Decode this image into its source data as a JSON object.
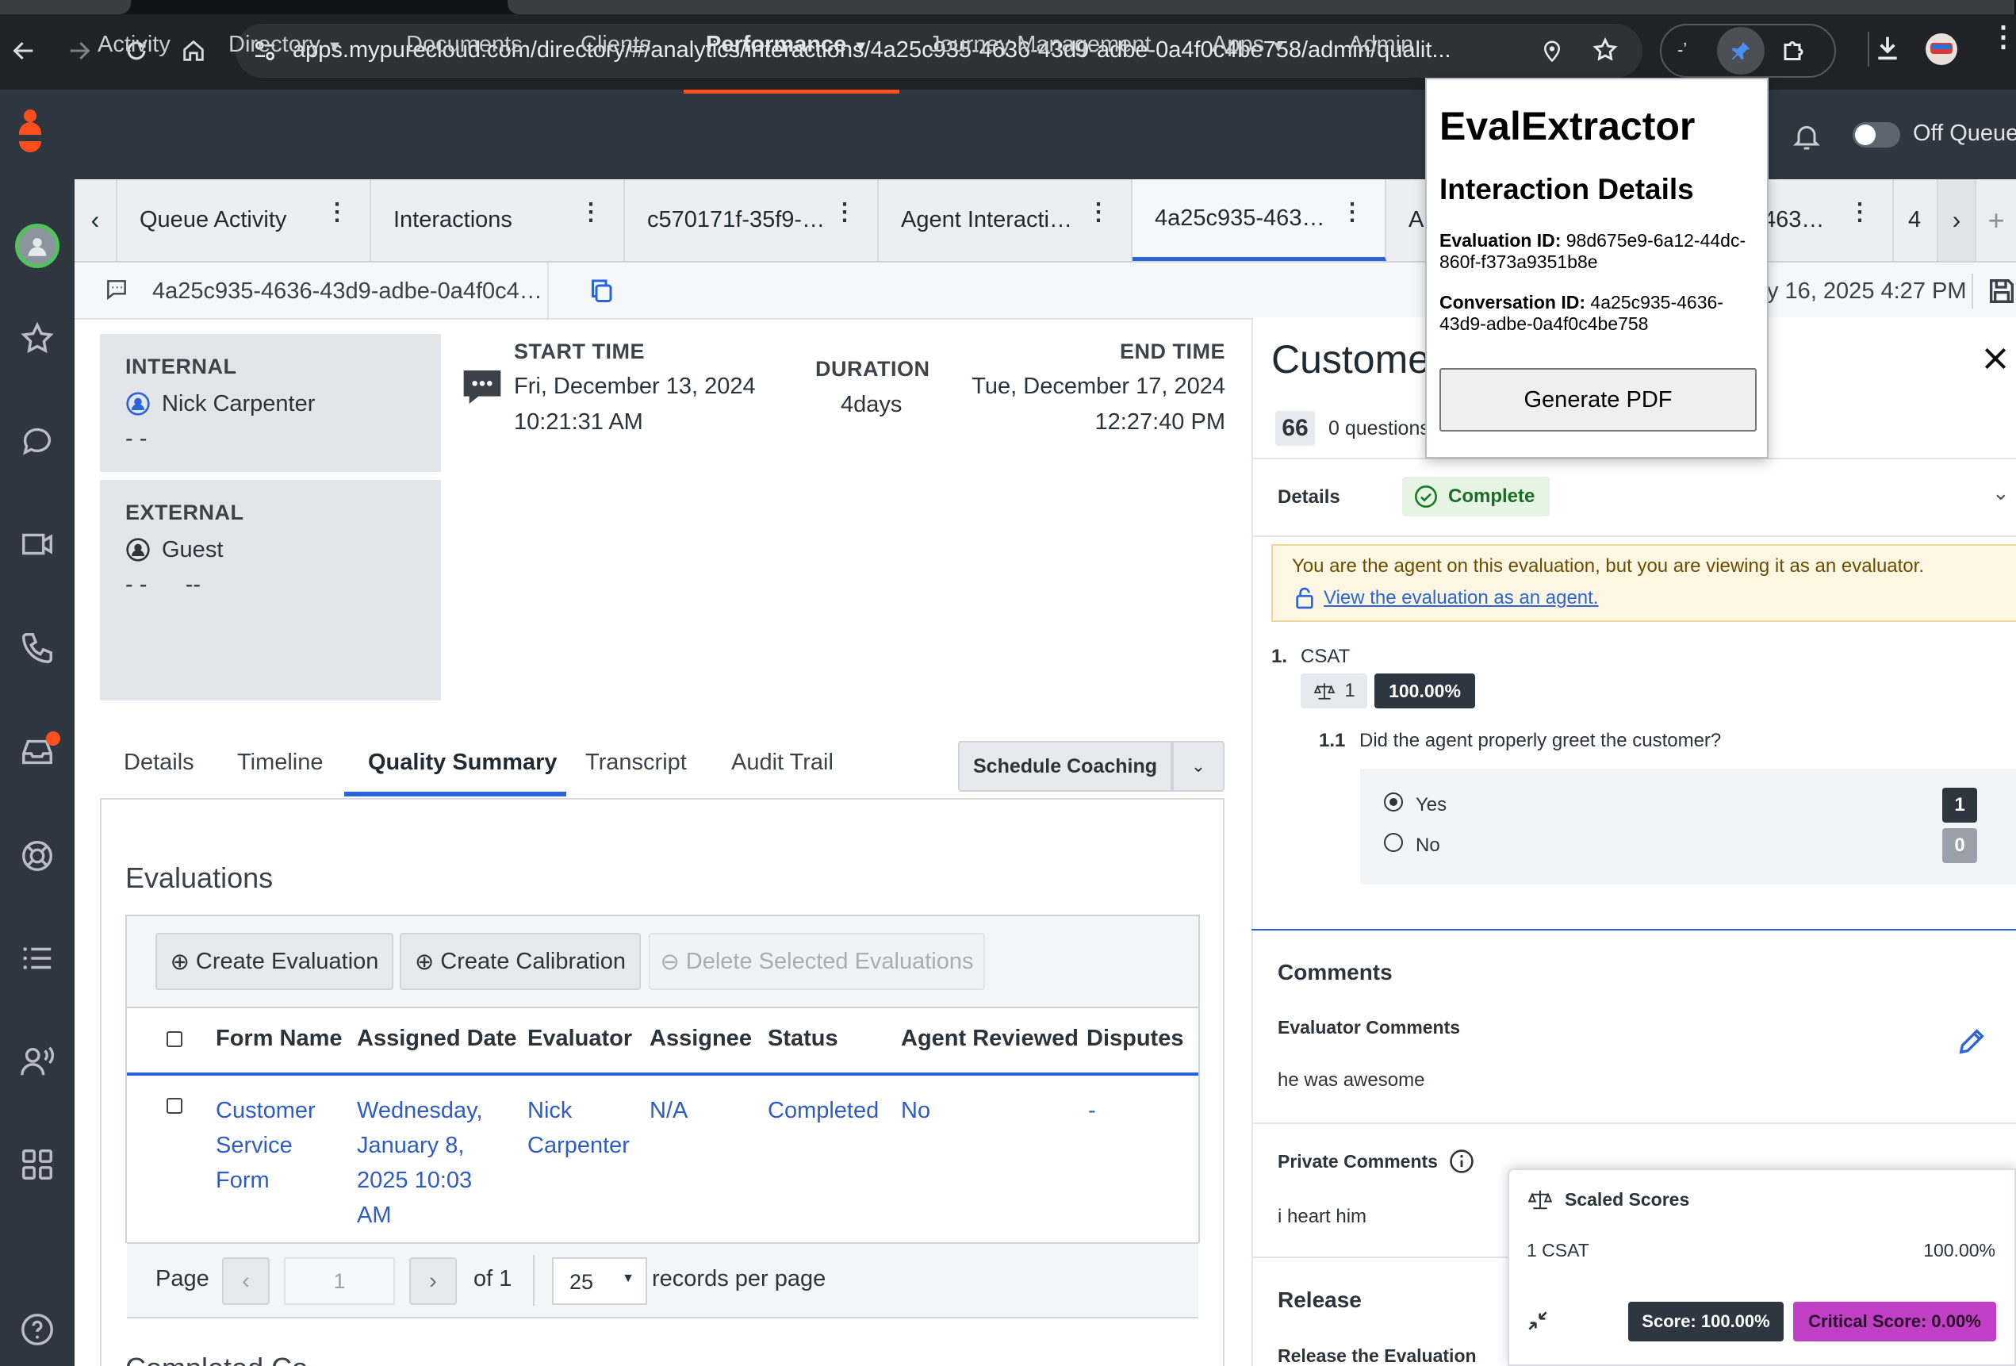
{
  "browser": {
    "url": "apps.mypurecloud.com/directory/#/analytics/interactions/4a25c935-4636-43d9-adbe-0a4f0c4be758/admin/qualit..."
  },
  "app_nav": {
    "items": [
      "Activity",
      "Directory",
      "Documents",
      "Clients",
      "Performance",
      "Journey Management",
      "Apps",
      "Admin"
    ],
    "active": "Performance",
    "queue_toggle_label": "Off Queue",
    "accent_color": "#ff4f1f"
  },
  "workspace_tabs": [
    "Queue Activity",
    "Interactions",
    "c570171f-35f9-…",
    "Agent Interacti…",
    "4a25c935-463…",
    "A",
    "…463…",
    "4"
  ],
  "subbar": {
    "interaction_id": "4a25c935-4636-43d9-adbe-0a4f0c4…",
    "date_text": "y 16, 2025 4:27 PM"
  },
  "participants": {
    "internal": {
      "label": "INTERNAL",
      "name": "Nick Carpenter",
      "sub": "- -"
    },
    "external": {
      "label": "EXTERNAL",
      "name": "Guest",
      "sub": "- -      --"
    }
  },
  "times": {
    "start_label": "START TIME",
    "start_date": "Fri, December 13, 2024",
    "start_time": "10:21:31 AM",
    "duration_label": "DURATION",
    "duration": "4days",
    "end_label": "END TIME",
    "end_date": "Tue, December 17, 2024",
    "end_time": "12:27:40 PM"
  },
  "page_tabs": [
    "Details",
    "Timeline",
    "Quality Summary",
    "Transcript",
    "Audit Trail"
  ],
  "active_page_tab": "Quality Summary",
  "schedule_coaching": "Schedule Coaching",
  "evaluations": {
    "title": "Evaluations",
    "buttons": {
      "create_eval": "Create Evaluation",
      "create_cal": "Create Calibration",
      "delete": "Delete Selected Evaluations"
    },
    "columns": [
      "Form Name",
      "Assigned Date",
      "Evaluator",
      "Assignee",
      "Status",
      "Agent Reviewed",
      "Disputes"
    ],
    "row": {
      "form_name": "Customer Service Form",
      "assigned_date": "Wednesday, January 8, 2025 10:03 AM",
      "evaluator": "Nick Carpenter",
      "assignee": "N/A",
      "status": "Completed",
      "agent_reviewed": "No",
      "disputes": "-"
    },
    "pager": {
      "page_label": "Page",
      "page_value": "1",
      "of": "of 1",
      "per_page": "25",
      "per_page_label": "records per page"
    },
    "next_heading": "Completed Co..."
  },
  "eval_panel": {
    "title": "Custome",
    "score_badge": "66",
    "questions_text": "0 questions",
    "details_label": "Details",
    "status": "Complete",
    "notice": "You are the agent on this evaluation, but you are viewing it as an evaluator.",
    "notice_link": "View the evaluation as an agent.",
    "section_num": "1.",
    "section_name": "CSAT",
    "weight": "1",
    "section_score": "100.00%",
    "question_num": "1.1",
    "question": "Did the agent properly greet the customer?",
    "answers": [
      {
        "label": "Yes",
        "value": "1"
      },
      {
        "label": "No",
        "value": "0"
      }
    ],
    "comments_title": "Comments",
    "evaluator_comments_label": "Evaluator Comments",
    "evaluator_comment": "he was awesome",
    "private_comments_label": "Private Comments",
    "private_comment": "i heart him",
    "release_title": "Release",
    "release_sub": "Release the Evaluation"
  },
  "popup": {
    "title": "EvalExtractor",
    "subtitle": "Interaction Details",
    "eval_id_label": "Evaluation ID:",
    "eval_id": "98d675e9-6a12-44dc-860f-f373a9351b8e",
    "conv_id_label": "Conversation ID:",
    "conv_id": "4a25c935-4636-43d9-adbe-0a4f0c4be758",
    "button": "Generate PDF"
  },
  "scaled_scores": {
    "title": "Scaled Scores",
    "row_label": "1 CSAT",
    "row_value": "100.00%",
    "score": "Score: 100.00%",
    "critical": "Critical Score: 0.00%",
    "critical_color": "#c13fc4"
  }
}
